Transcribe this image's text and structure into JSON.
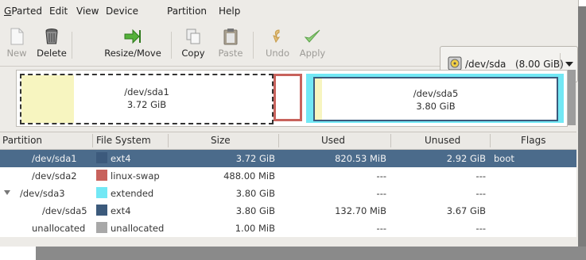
{
  "menu": [
    {
      "label": "GParted",
      "mnemonic": "G"
    },
    {
      "label": "Edit",
      "mnemonic": "E"
    },
    {
      "label": "View",
      "mnemonic": "V"
    },
    {
      "label": "Device",
      "mnemonic": "D"
    },
    {
      "label": "Partition",
      "mnemonic": "P"
    },
    {
      "label": "Help",
      "mnemonic": "H"
    }
  ],
  "toolbar": {
    "new": "New",
    "delete": "Delete",
    "resize_move": "Resize/Move",
    "copy": "Copy",
    "paste": "Paste",
    "undo": "Undo",
    "apply": "Apply"
  },
  "device_selector": {
    "device": "/dev/sda",
    "size": "(8.00 GiB)"
  },
  "map": {
    "sda1": {
      "name": "/dev/sda1",
      "size": "3.72 GiB",
      "used_fraction": 0.21
    },
    "sda5": {
      "name": "/dev/sda5",
      "size": "3.80 GiB",
      "used_fraction": 0.03
    }
  },
  "table": {
    "headers": {
      "partition": "Partition",
      "filesystem": "File System",
      "size": "Size",
      "used": "Used",
      "unused": "Unused",
      "flags": "Flags"
    },
    "rows": [
      {
        "partition": "/dev/sda1",
        "filesystem": "ext4",
        "size": "3.72 GiB",
        "used": "820.53 MiB",
        "unused": "2.92 GiB",
        "flags": "boot",
        "color": "#4b6b8b"
      },
      {
        "partition": "/dev/sda2",
        "filesystem": "linux-swap",
        "size": "488.00 MiB",
        "used": "---",
        "unused": "---",
        "flags": "",
        "color": "#c8625c"
      },
      {
        "partition": "/dev/sda3",
        "filesystem": "extended",
        "size": "3.80 GiB",
        "used": "---",
        "unused": "---",
        "flags": "",
        "color": "#72e8f5"
      },
      {
        "partition": "/dev/sda5",
        "filesystem": "ext4",
        "size": "3.80 GiB",
        "used": "132.70 MiB",
        "unused": "3.67 GiB",
        "flags": "",
        "color": "#3c5a7c"
      },
      {
        "partition": "unallocated",
        "filesystem": "unallocated",
        "size": "1.00 MiB",
        "used": "---",
        "unused": "---",
        "flags": "",
        "color": "#a8a8a8"
      }
    ]
  },
  "colors": {
    "selection": "#4b6b8b",
    "ext4": "#3c5a7c",
    "linux_swap": "#c8625c",
    "extended": "#72e8f5",
    "unallocated": "#a8a8a8",
    "used_fill": "#f7f5c0"
  }
}
